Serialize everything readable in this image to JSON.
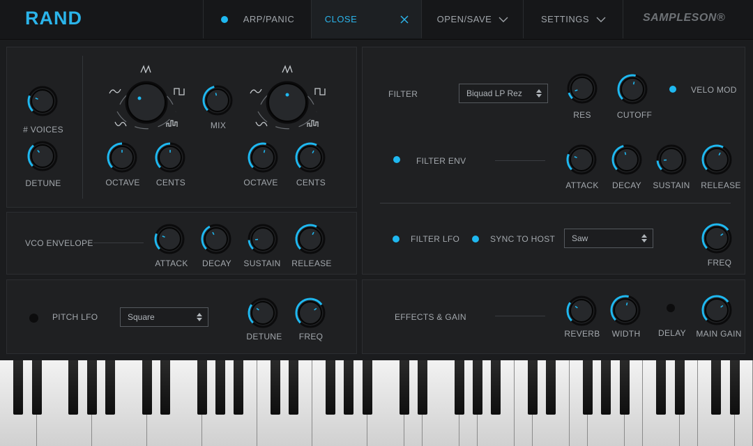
{
  "header": {
    "title": "RAND",
    "arp_label": "ARP/PANIC",
    "close_label": "CLOSE",
    "open_save_label": "OPEN/SAVE",
    "settings_label": "SETTINGS",
    "brand": "SAMPLESON®"
  },
  "oscillator": {
    "voices_label": "# VOICES",
    "detune_label": "DETUNE",
    "mix_label": "MIX",
    "octave_label": "OCTAVE",
    "cents_label": "CENTS"
  },
  "vco_envelope": {
    "title": "VCO ENVELOPE",
    "attack_label": "ATTACK",
    "decay_label": "DECAY",
    "sustain_label": "SUSTAIN",
    "release_label": "RELEASE"
  },
  "pitch_lfo": {
    "title": "PITCH LFO",
    "wave": "Square",
    "detune_label": "DETUNE",
    "freq_label": "FREQ"
  },
  "filter": {
    "title": "FILTER",
    "type": "Biquad LP Rez",
    "res_label": "RES",
    "cutoff_label": "CUTOFF",
    "velo_mod_label": "VELO MOD",
    "env_label": "FILTER ENV",
    "attack_label": "ATTACK",
    "decay_label": "DECAY",
    "sustain_label": "SUSTAIN",
    "release_label": "RELEASE",
    "lfo_label": "FILTER LFO",
    "sync_label": "SYNC TO HOST",
    "lfo_wave": "Saw",
    "freq_label": "FREQ"
  },
  "effects": {
    "title": "EFFECTS & GAIN",
    "reverb_label": "REVERB",
    "width_label": "WIDTH",
    "delay_label": "DELAY",
    "main_gain_label": "MAIN GAIN"
  },
  "colors": {
    "accent": "#1fb8f0",
    "panel": "#1f2022",
    "background": "#1b1c1e"
  }
}
